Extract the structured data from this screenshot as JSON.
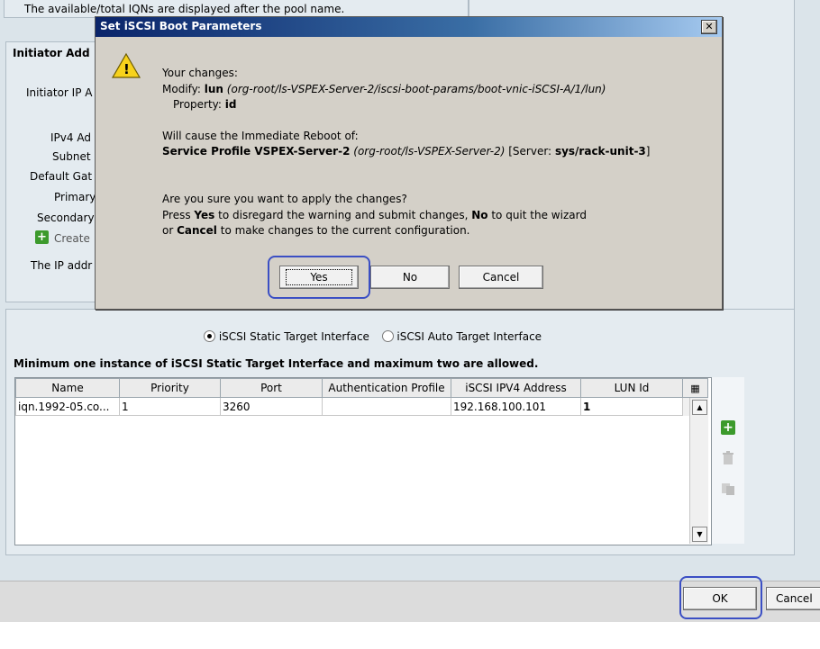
{
  "background": {
    "pool_note": "The available/total IQNs are displayed after the pool name.",
    "initiator_section_title": "Initiator Add",
    "initiator_ip_label": "Initiator IP A",
    "ipv4_label": "IPv4 Ad",
    "subnet_label": "Subnet",
    "gateway_label": "Default Gat",
    "primary_label": "Primary",
    "secondary_label": "Secondary",
    "create_label": "Create",
    "ip_note": "The IP addr"
  },
  "target": {
    "radio_static": "iSCSI Static Target Interface",
    "radio_auto": "iSCSI Auto Target Interface",
    "static_selected": true,
    "note": "Minimum one instance of iSCSI Static Target Interface and maximum two are allowed.",
    "columns": [
      "Name",
      "Priority",
      "Port",
      "Authentication Profile",
      "iSCSI IPV4 Address",
      "LUN Id"
    ],
    "rows": [
      [
        "iqn.1992-05.co...",
        "1",
        "3260",
        "",
        "192.168.100.101",
        "1"
      ]
    ]
  },
  "footer": {
    "ok_label": "OK",
    "cancel_label": "Cancel"
  },
  "dialog": {
    "title": "Set iSCSI Boot Parameters",
    "close_glyph": "✕",
    "warning_glyph": "!",
    "your_changes": "Your changes:",
    "modify_prefix": "Modify:",
    "modify_obj": "lun",
    "modify_path": "(org-root/ls-VSPEX-Server-2/iscsi-boot-params/boot-vnic-iSCSI-A/1/lun)",
    "property_prefix": "Property:",
    "property_value": "id",
    "reboot_intro": "Will cause the Immediate Reboot of:",
    "reboot_target": "Service Profile VSPEX-Server-2",
    "reboot_path": "(org-root/ls-VSPEX-Server-2)",
    "server_prefix": "[Server:",
    "server_value": "sys/rack-unit-3",
    "server_suffix": "]",
    "question": "Are you sure you want to apply the changes?",
    "press": "Press",
    "yes_word": "Yes",
    "line2_mid": "to disregard the warning and submit changes,",
    "no_word": "No",
    "line2_end": "to quit the wizard",
    "or": "or",
    "cancel_word": "Cancel",
    "line3_end": "to make changes to the current configuration.",
    "yes_label": "Yes",
    "no_label": "No",
    "cancel_label": "Cancel"
  },
  "colors": {
    "title_bar": "#0a246a",
    "highlight": "#3b4fc4",
    "add_green": "#3c9a2c"
  }
}
